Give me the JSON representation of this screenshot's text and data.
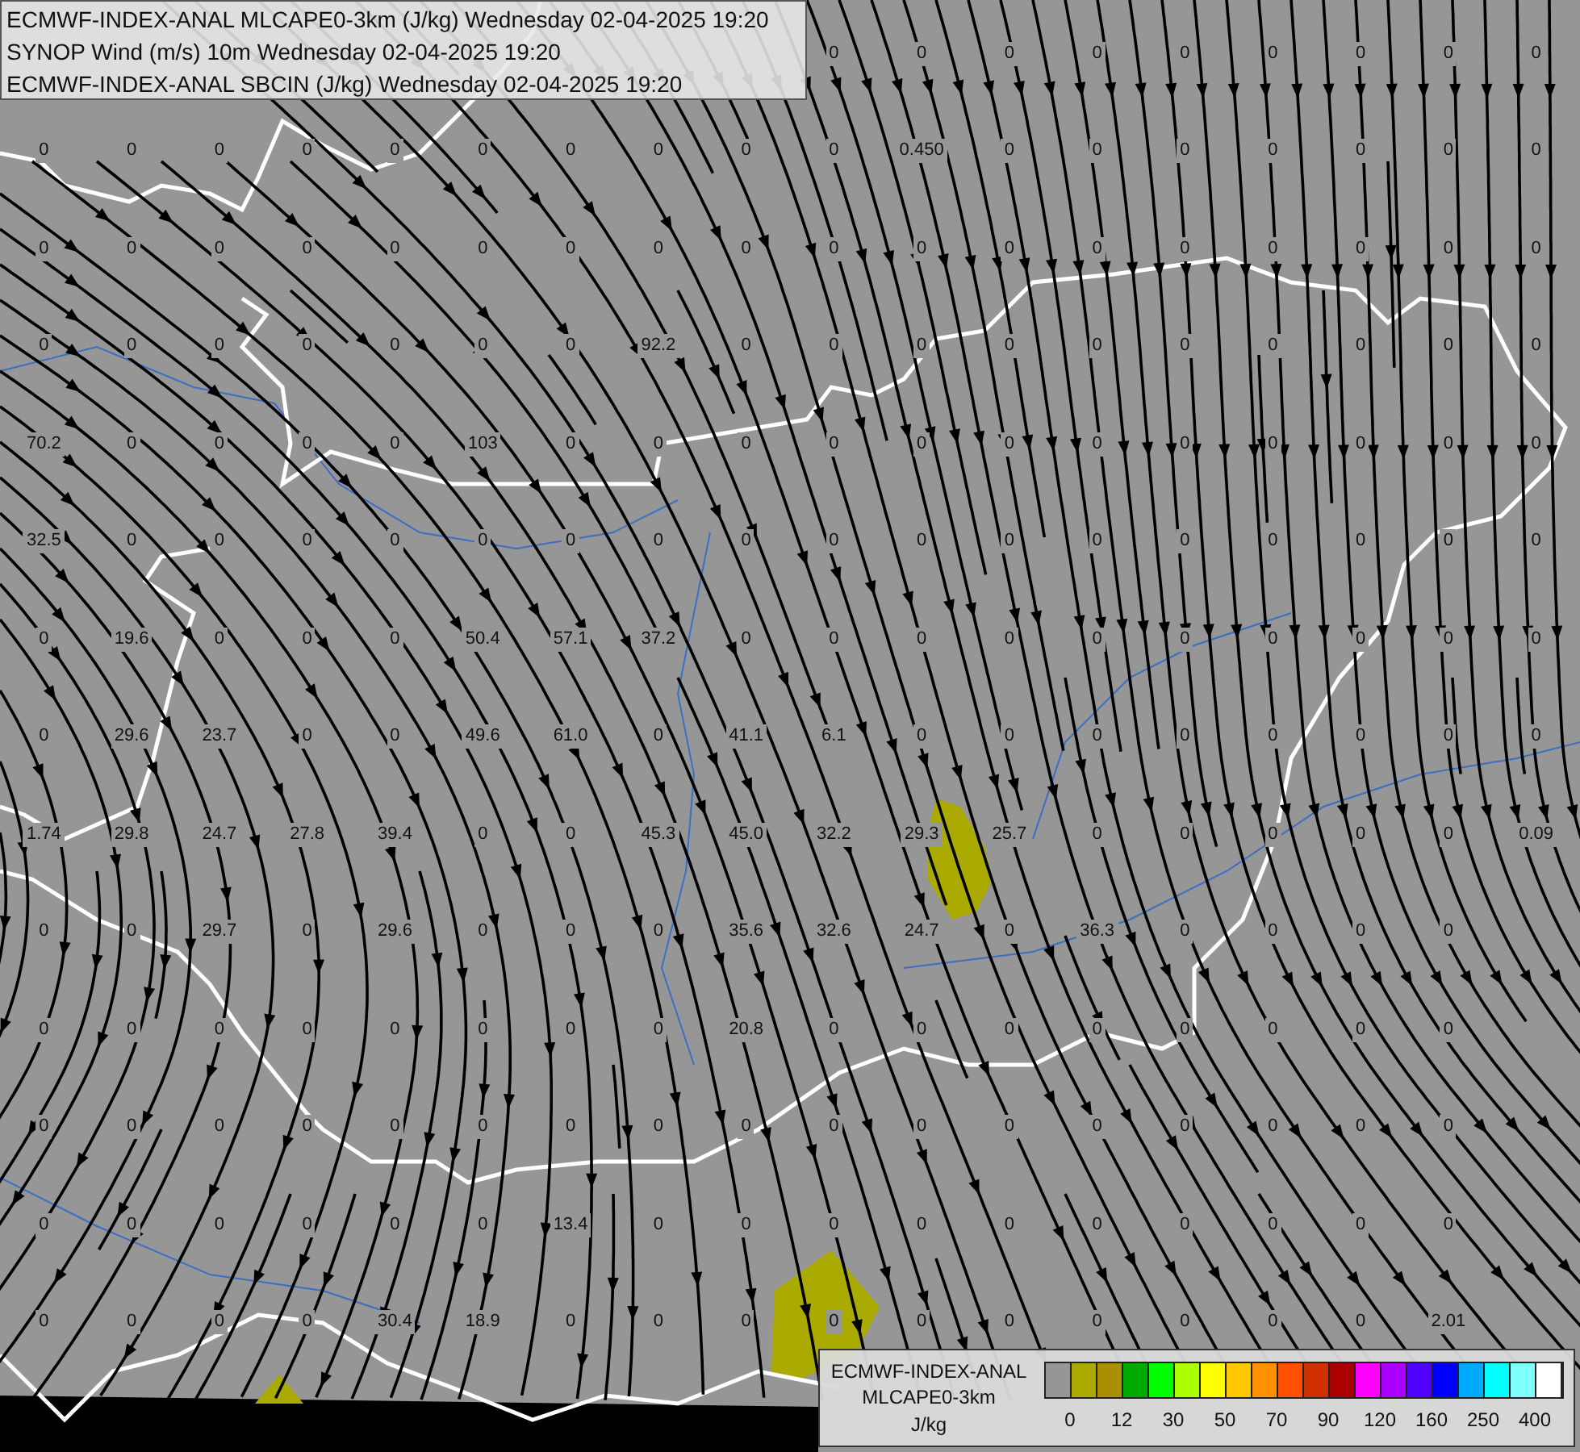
{
  "header": {
    "lines": [
      "ECMWF-INDEX-ANAL MLCAPE0-3km (J/kg) Wednesday 02-04-2025 19:20",
      "SYNOP Wind (m/s) 10m Wednesday 02-04-2025 19:20",
      "ECMWF-INDEX-ANAL SBCIN (J/kg) Wednesday 02-04-2025 19:20"
    ]
  },
  "map": {
    "value_rows": [
      [
        null,
        null,
        null,
        null,
        null,
        null,
        null,
        null,
        null,
        "0",
        "0",
        "0",
        "0",
        "0",
        "0",
        "0",
        "0",
        "0"
      ],
      [
        "0",
        "0",
        "0",
        "0",
        "0",
        "0",
        "0",
        "0",
        "0",
        "0",
        "0.450",
        "0",
        "0",
        "0",
        "0",
        "0",
        "0",
        "0"
      ],
      [
        "0",
        "0",
        "0",
        "0",
        "0",
        "0",
        "0",
        "0",
        "0",
        "0",
        "0",
        "0",
        "0",
        "0",
        "0",
        "0",
        "0",
        "0"
      ],
      [
        "0",
        "0",
        "0",
        "0",
        "0",
        "0",
        "0",
        "92.2",
        "0",
        "0",
        "0",
        "0",
        "0",
        "0",
        "0",
        "0",
        "0",
        "0"
      ],
      [
        "70.2",
        "0",
        "0",
        "0",
        "0",
        "103",
        "0",
        "0",
        "0",
        "0",
        "0",
        "0",
        "0",
        "0",
        "0",
        "0",
        "0",
        "0"
      ],
      [
        "32.5",
        "0",
        "0",
        "0",
        "0",
        "0",
        "0",
        "0",
        "0",
        "0",
        "0",
        "0",
        "0",
        "0",
        "0",
        "0",
        "0",
        "0"
      ],
      [
        "0",
        "19.6",
        "0",
        "0",
        "0",
        "50.4",
        "57.1",
        "37.2",
        "0",
        "0",
        "0",
        "0",
        "0",
        "0",
        "0",
        "0",
        "0",
        "0"
      ],
      [
        "0",
        "29.6",
        "23.7",
        "0",
        "0",
        "49.6",
        "61.0",
        "0",
        "41.1",
        "6.1",
        "0",
        "0",
        "0",
        "0",
        "0",
        "0",
        "0",
        "0"
      ],
      [
        "1.74",
        "29.8",
        "24.7",
        "27.8",
        "39.4",
        "0",
        "0",
        "45.3",
        "45.0",
        "32.2",
        "29.3",
        "25.7",
        "0",
        "0",
        "0",
        "0",
        "0",
        "0.09"
      ],
      [
        "0",
        "0",
        "29.7",
        "0",
        "29.6",
        "0",
        "0",
        "0",
        "35.6",
        "32.6",
        "24.7",
        "0",
        "36.3",
        "0",
        "0",
        "0",
        "0",
        null
      ],
      [
        "0",
        "0",
        "0",
        "0",
        "0",
        "0",
        "0",
        "0",
        "20.8",
        "0",
        "0",
        "0",
        "0",
        "0",
        "0",
        "0",
        "0",
        null
      ],
      [
        "0",
        "0",
        "0",
        "0",
        "0",
        "0",
        "0",
        "0",
        "0",
        "0",
        "0",
        "0",
        "0",
        "0",
        "0",
        "0",
        "0",
        null
      ],
      [
        "0",
        "0",
        "0",
        "0",
        "0",
        "0",
        "13.4",
        "0",
        "0",
        "0",
        "0",
        "0",
        "0",
        "0",
        "0",
        "0",
        "0",
        null
      ],
      [
        "0",
        "0",
        "0",
        "0",
        "30.4",
        "18.9",
        "0",
        "0",
        "0",
        "0",
        "0",
        "0",
        "0",
        "0",
        "0",
        "0",
        "2.01",
        null
      ]
    ]
  },
  "legend": {
    "title_lines": [
      "ECMWF-INDEX-ANAL",
      "MLCAPE0-3km"
    ],
    "unit": "J/kg",
    "swatches": [
      {
        "color": "#969696"
      },
      {
        "color": "#aaaa00"
      },
      {
        "color": "#aa9000"
      },
      {
        "color": "#00aa00"
      },
      {
        "color": "#00ff00"
      },
      {
        "color": "#aaff00"
      },
      {
        "color": "#ffff00"
      },
      {
        "color": "#ffc800"
      },
      {
        "color": "#ff9000"
      },
      {
        "color": "#ff5000"
      },
      {
        "color": "#d03000"
      },
      {
        "color": "#aa0000"
      },
      {
        "color": "#ff00ff"
      },
      {
        "color": "#aa00ff"
      },
      {
        "color": "#5000ff"
      },
      {
        "color": "#0000ff"
      },
      {
        "color": "#00aaff"
      },
      {
        "color": "#00ffff"
      },
      {
        "color": "#80ffff"
      },
      {
        "color": "#ffffff"
      }
    ],
    "tick_labels": [
      "0",
      "12",
      "30",
      "50",
      "70",
      "90",
      "120",
      "160",
      "250",
      "400"
    ]
  }
}
